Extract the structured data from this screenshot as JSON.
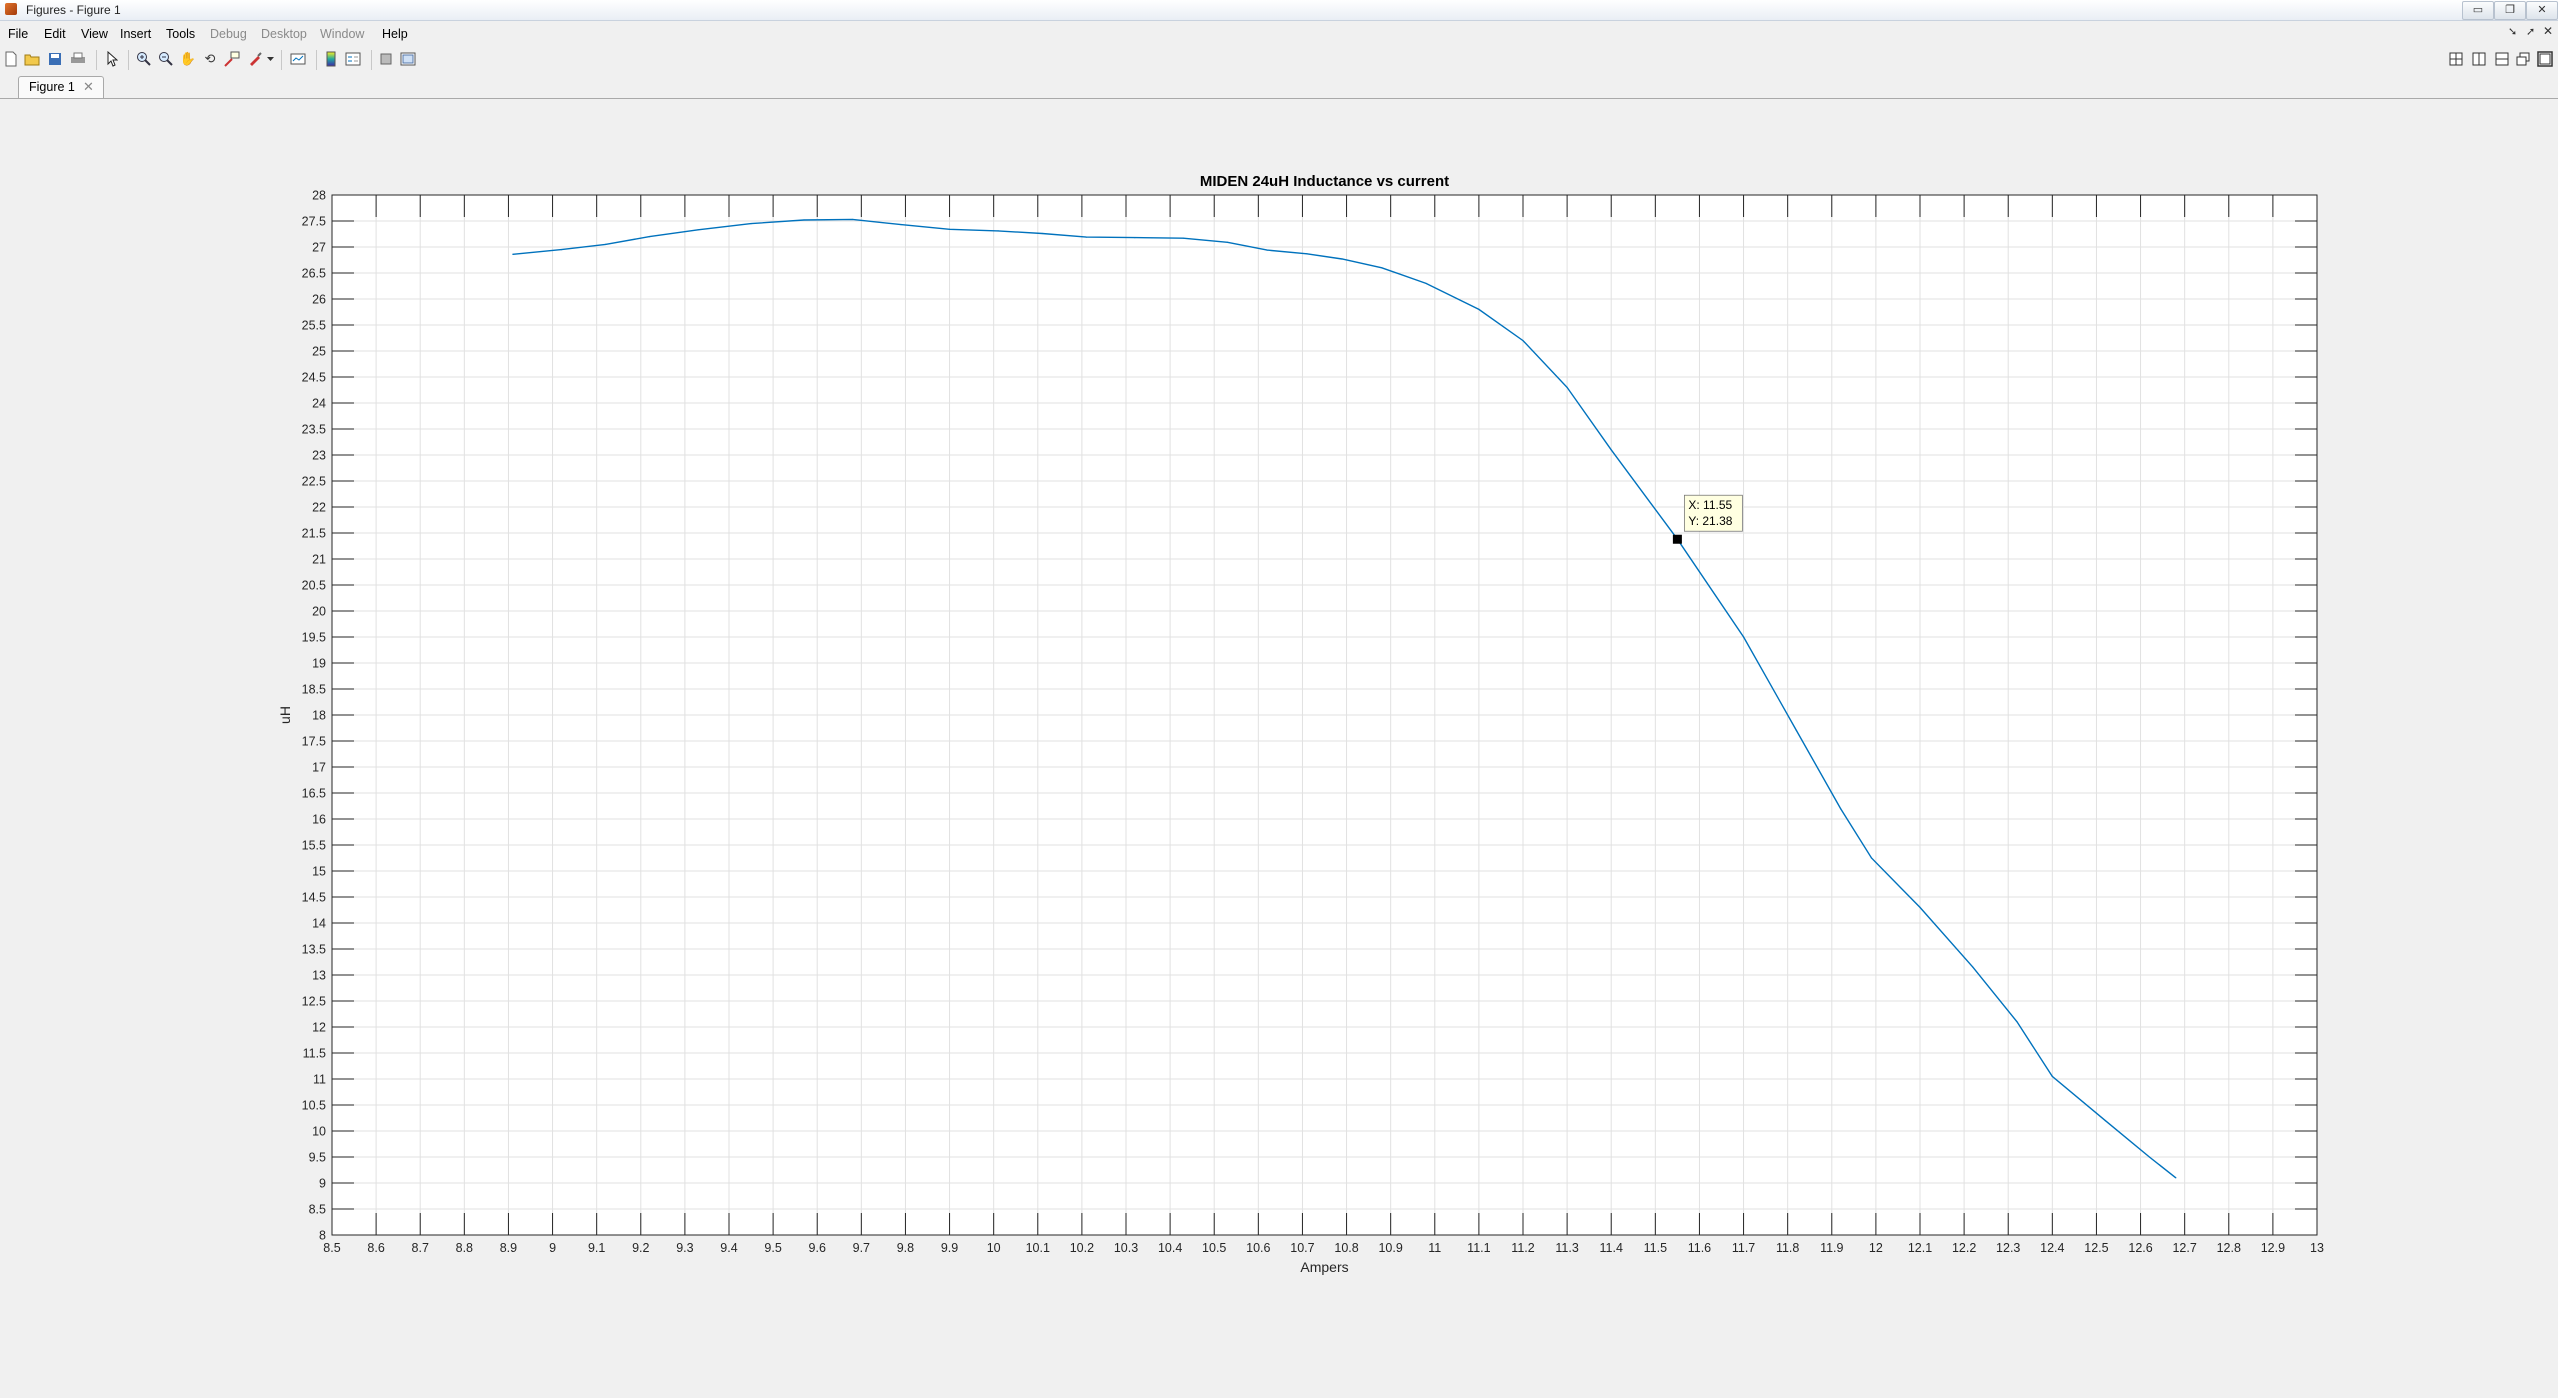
{
  "window": {
    "title": "Figures - Figure 1",
    "min_glyph": "▭",
    "restore_glyph": "❐",
    "close_glyph": "✕"
  },
  "menu": [
    "File",
    "Edit",
    "View",
    "Insert",
    "Tools",
    "Debug",
    "Desktop",
    "Window",
    "Help"
  ],
  "menu_disabled": [
    "Debug",
    "Desktop",
    "Window"
  ],
  "toolbar": {
    "icons": [
      "new-figure-icon",
      "open-file-icon",
      "save-icon",
      "print-icon",
      "pointer-icon",
      "zoom-in-icon",
      "zoom-out-icon",
      "pan-icon",
      "rotate-3d-icon",
      "data-cursor-icon",
      "brush-icon",
      "brush-dropdown-icon",
      "link-plot-icon",
      "colorbar-icon",
      "legend-icon",
      "hide-plot-tools-icon",
      "show-plot-tools-icon"
    ],
    "layout_icons": [
      "tile-grid-icon",
      "tile-columns-icon",
      "tile-rows-icon",
      "float-icon",
      "maximize-icon"
    ]
  },
  "tabs": [
    {
      "label": "Figure 1",
      "close_glyph": "✕"
    }
  ],
  "colors": {
    "line": "#0072bd",
    "grid": "#e1e1e1",
    "axes": "#262626",
    "datatip_bg": "#ffffe1"
  },
  "chart_data": {
    "type": "line",
    "title": "MIDEN 24uH Inductance vs current",
    "xlabel": "Ampers",
    "ylabel": "uH",
    "xlim": [
      8.5,
      13
    ],
    "ylim": [
      8,
      28
    ],
    "xticks": [
      8.5,
      8.6,
      8.7,
      8.8,
      8.9,
      9,
      9.1,
      9.2,
      9.3,
      9.4,
      9.5,
      9.6,
      9.7,
      9.8,
      9.9,
      10,
      10.1,
      10.2,
      10.3,
      10.4,
      10.5,
      10.6,
      10.7,
      10.8,
      10.9,
      11,
      11.1,
      11.2,
      11.3,
      11.4,
      11.5,
      11.6,
      11.7,
      11.8,
      11.9,
      12,
      12.1,
      12.2,
      12.3,
      12.4,
      12.5,
      12.6,
      12.7,
      12.8,
      12.9,
      13
    ],
    "yticks": [
      8,
      8.5,
      9,
      9.5,
      10,
      10.5,
      11,
      11.5,
      12,
      12.5,
      13,
      13.5,
      14,
      14.5,
      15,
      15.5,
      16,
      16.5,
      17,
      17.5,
      18,
      18.5,
      19,
      19.5,
      20,
      20.5,
      21,
      21.5,
      22,
      22.5,
      23,
      23.5,
      24,
      24.5,
      25,
      25.5,
      26,
      26.5,
      27,
      27.5,
      28
    ],
    "grid": true,
    "series": [
      {
        "x": [
          8.91,
          9.02,
          9.12,
          9.22,
          9.33,
          9.45,
          9.57,
          9.68,
          9.79,
          9.9,
          10.01,
          10.11,
          10.21,
          10.32,
          10.43,
          10.53,
          10.62,
          10.71,
          10.79,
          10.88,
          10.98,
          11.1,
          11.2,
          11.3,
          11.4,
          11.55,
          11.7,
          11.82,
          11.92,
          11.99,
          12.1,
          12.22,
          12.32,
          12.4,
          12.52,
          12.62,
          12.68
        ],
        "y": [
          26.86,
          26.95,
          27.05,
          27.2,
          27.33,
          27.45,
          27.52,
          27.53,
          27.43,
          27.34,
          27.31,
          27.26,
          27.19,
          27.18,
          27.17,
          27.09,
          26.94,
          26.87,
          26.77,
          26.6,
          26.3,
          25.8,
          25.2,
          24.3,
          23.1,
          21.38,
          19.5,
          17.7,
          16.2,
          15.25,
          14.3,
          13.15,
          12.1,
          11.05,
          10.2,
          9.5,
          9.1
        ]
      }
    ],
    "datatip": {
      "x": 11.55,
      "y": 21.38,
      "x_label": "X: 11.55",
      "y_label": "Y: 21.38"
    }
  }
}
